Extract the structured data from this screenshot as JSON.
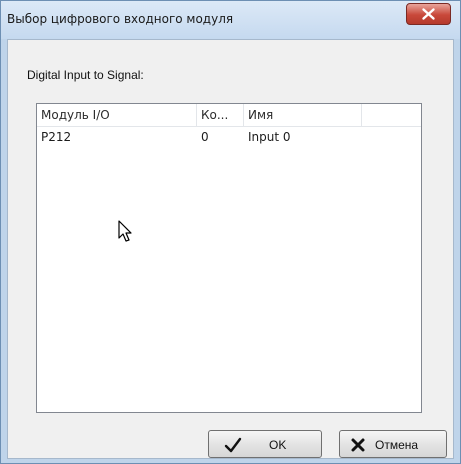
{
  "window": {
    "title": "Выбор цифрового входного модуля"
  },
  "dialog": {
    "caption": "Digital Input to Signal:"
  },
  "list": {
    "columns": [
      "Модуль I/O",
      "Ко...",
      "Имя"
    ],
    "rows": [
      {
        "module": "P212",
        "channel": "0",
        "name": "Input 0"
      }
    ]
  },
  "buttons": {
    "ok_label": "OK",
    "cancel_label": "Отмена"
  },
  "icons": {
    "close": "close-icon",
    "ok": "checkmark-icon",
    "cancel": "cross-icon",
    "cursor": "mouse-pointer-icon"
  },
  "colors": {
    "close_button": "#c8483a",
    "title_bar": "#c5d9ef"
  }
}
